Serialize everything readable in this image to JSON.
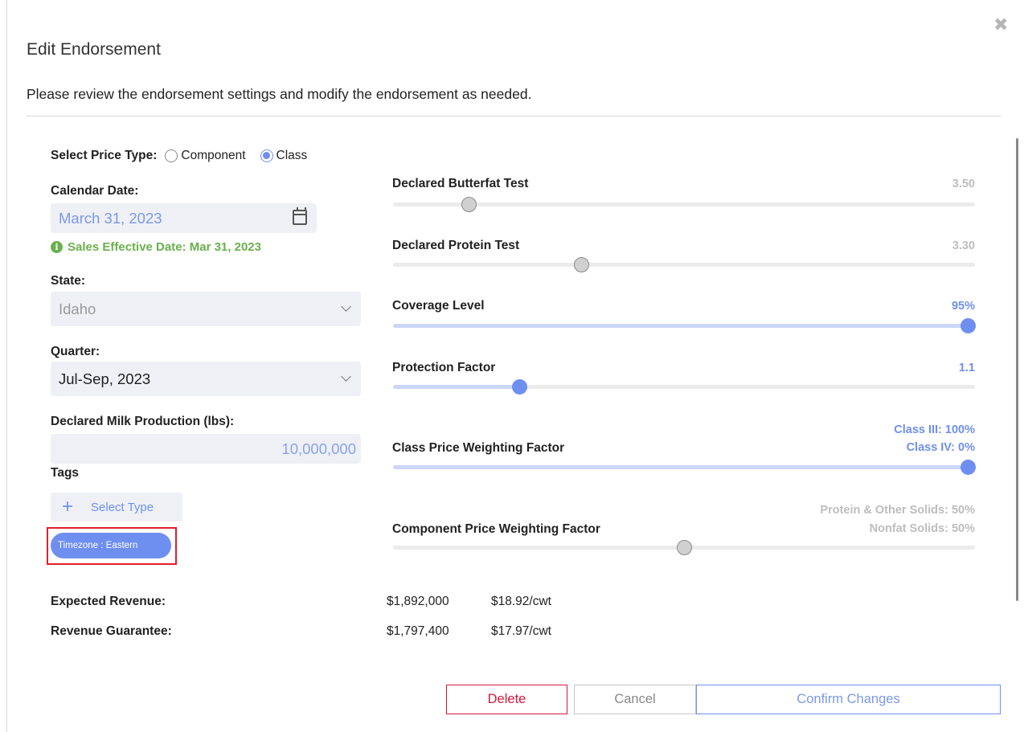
{
  "dialog": {
    "title": "Edit Endorsement",
    "subtitle": "Please review the endorsement settings and modify the endorsement as needed.",
    "close_icon": "close-icon"
  },
  "price_type": {
    "label": "Select Price Type:",
    "options": [
      "Component",
      "Class"
    ],
    "selected": "Class"
  },
  "calendar": {
    "label": "Calendar Date:",
    "value": "March 31, 2023",
    "icon": "calendar-icon",
    "sales_effective": "Sales Effective Date: Mar 31, 2023"
  },
  "state": {
    "label": "State:",
    "value": "Idaho",
    "disabled": true
  },
  "quarter": {
    "label": "Quarter:",
    "value": "Jul-Sep, 2023"
  },
  "milk": {
    "label": "Declared Milk Production (lbs):",
    "value": "10,000,000"
  },
  "tags": {
    "label": "Tags",
    "add_label": "Select Type",
    "items": [
      "Timezone : Eastern"
    ]
  },
  "sliders": {
    "butterfat": {
      "label": "Declared Butterfat Test",
      "value": "3.50",
      "level": 0.12
    },
    "protein": {
      "label": "Declared Protein Test",
      "value": "3.30",
      "level": 0.318
    },
    "coverage": {
      "label": "Coverage Level",
      "value": "95%",
      "level": 1.0
    },
    "protection": {
      "label": "Protection Factor",
      "value": "1.1",
      "level": 0.21
    },
    "class_weight": {
      "label": "Class Price Weighting Factor",
      "value_line1": "Class III: 100%",
      "value_line2": "Class IV: 0%",
      "level": 1.0
    },
    "component_weight": {
      "label": "Component Price Weighting Factor",
      "value_line1": "Protein & Other Solids: 50%",
      "value_line2": "Nonfat Solids: 50%",
      "level": 0.5
    }
  },
  "revenue": {
    "expected_label": "Expected Revenue:",
    "expected_total": "$1,892,000",
    "expected_cwt": "$18.92/cwt",
    "guarantee_label": "Revenue Guarantee:",
    "guarantee_total": "$1,797,400",
    "guarantee_cwt": "$17.97/cwt"
  },
  "buttons": {
    "delete": "Delete",
    "cancel": "Cancel",
    "confirm": "Confirm Changes"
  },
  "colors": {
    "accent": "#6f8ff0",
    "success": "#6ab04c",
    "danger": "#d21a3a",
    "highlight": "#e11d2a"
  }
}
